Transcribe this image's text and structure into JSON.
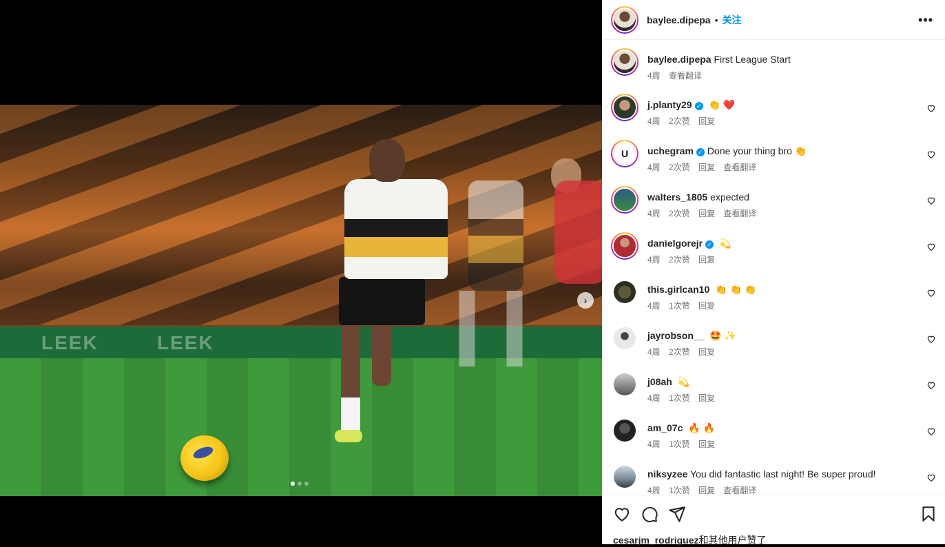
{
  "post": {
    "author": "baylee.dipepa",
    "follow_label": "关注",
    "separator": "•",
    "more_label": "•••",
    "next_label": "›",
    "banner_text": [
      "LEEK",
      "LEEK"
    ]
  },
  "caption": {
    "username": "baylee.dipepa",
    "text": "First League Start",
    "time": "4周",
    "translate": "查看翻译"
  },
  "comments": [
    {
      "username": "j.planty29",
      "verified": true,
      "text": "",
      "emoji": "👏 ❤️",
      "time": "4周",
      "likes": "2次赞",
      "reply": "回复",
      "translate": ""
    },
    {
      "username": "uchegram",
      "verified": true,
      "text": "Done your thing bro",
      "emoji": "👏",
      "time": "4周",
      "likes": "2次赞",
      "reply": "回复",
      "translate": "查看翻译"
    },
    {
      "username": "walters_1805",
      "verified": false,
      "text": "expected",
      "emoji": "",
      "time": "4周",
      "likes": "2次赞",
      "reply": "回复",
      "translate": "查看翻译"
    },
    {
      "username": "danielgorejr",
      "verified": true,
      "text": "",
      "emoji": "💫",
      "time": "4周",
      "likes": "2次赞",
      "reply": "回复",
      "translate": ""
    },
    {
      "username": "this.girlcan10",
      "verified": false,
      "text": "",
      "emoji": "👏 👏 👏",
      "time": "4周",
      "likes": "1次赞",
      "reply": "回复",
      "translate": ""
    },
    {
      "username": "jayrobson__",
      "verified": false,
      "text": "",
      "emoji": "🤩 ✨",
      "time": "4周",
      "likes": "2次赞",
      "reply": "回复",
      "translate": ""
    },
    {
      "username": "j08ah",
      "verified": false,
      "text": "",
      "emoji": "💫",
      "time": "4周",
      "likes": "1次赞",
      "reply": "回复",
      "translate": ""
    },
    {
      "username": "am_07c",
      "verified": false,
      "text": "",
      "emoji": "🔥 🔥",
      "time": "4周",
      "likes": "1次赞",
      "reply": "回复",
      "translate": ""
    },
    {
      "username": "niksyzee",
      "verified": false,
      "text": "You did fantastic last night! Be super proud!",
      "emoji": "",
      "time": "4周",
      "likes": "1次赞",
      "reply": "回复",
      "translate": "查看翻译"
    }
  ],
  "footer": {
    "liked_by": "cesarjm_rodriguez",
    "liked_suffix": "和其他用户赞了"
  },
  "colors": {
    "accent": "#0095f6",
    "text": "#262626",
    "muted": "#737373"
  },
  "carousel": {
    "slide_count": 3,
    "active_index": 0
  }
}
